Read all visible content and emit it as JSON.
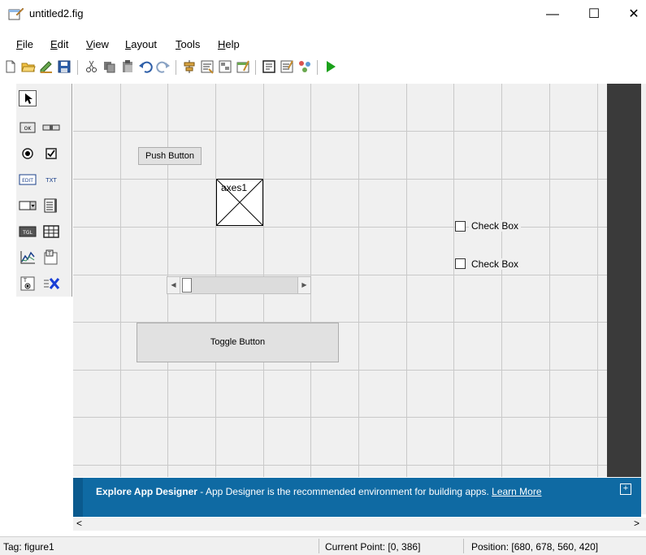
{
  "window": {
    "title": "untitled2.fig",
    "minimize_glyph": "—",
    "maximize_glyph": "☐",
    "close_glyph": "✕"
  },
  "menu": {
    "items": [
      {
        "mnemonic": "F",
        "rest": "ile"
      },
      {
        "mnemonic": "E",
        "rest": "dit"
      },
      {
        "mnemonic": "V",
        "rest": "iew"
      },
      {
        "mnemonic": "L",
        "rest": "ayout"
      },
      {
        "mnemonic": "T",
        "rest": "ools"
      },
      {
        "mnemonic": "H",
        "rest": "elp"
      }
    ]
  },
  "toolbar": {
    "icons": [
      "new-file-icon",
      "open-folder-icon",
      "edit-icon",
      "save-icon",
      "cut-icon",
      "copy-icon",
      "paste-icon",
      "undo-icon",
      "redo-icon",
      "align-icon",
      "menu-editor-icon",
      "tab-order-icon",
      "toolbar-editor-icon",
      "editor-icon",
      "property-inspector-icon",
      "object-browser-icon",
      "run-icon"
    ]
  },
  "palette": {
    "items": [
      {
        "name": "select-tool-icon",
        "glyph": "➤"
      },
      {
        "name": "push-button-tool-icon",
        "glyph": "OK"
      },
      {
        "name": "slider-tool-icon",
        "glyph": "▭"
      },
      {
        "name": "radio-button-tool-icon",
        "glyph": "◉"
      },
      {
        "name": "check-box-tool-icon",
        "glyph": "☑"
      },
      {
        "name": "edit-text-tool-icon",
        "glyph": "EDIT"
      },
      {
        "name": "static-text-tool-icon",
        "glyph": "TXT"
      },
      {
        "name": "popup-menu-tool-icon",
        "glyph": "▭"
      },
      {
        "name": "listbox-tool-icon",
        "glyph": "☰"
      },
      {
        "name": "toggle-button-tool-icon",
        "glyph": "TGL"
      },
      {
        "name": "table-tool-icon",
        "glyph": "▦"
      },
      {
        "name": "axes-tool-icon",
        "glyph": "📈"
      },
      {
        "name": "panel-tool-icon",
        "glyph": "T"
      },
      {
        "name": "button-group-tool-icon",
        "glyph": "T"
      },
      {
        "name": "activex-tool-icon",
        "glyph": "X"
      }
    ]
  },
  "canvas": {
    "push_button_label": "Push Button",
    "axes_label": "axes1",
    "toggle_button_label": "Toggle Button",
    "checkbox1_label": "Check Box",
    "checkbox2_label": "Check Box",
    "slider_left_glyph": "◀",
    "slider_right_glyph": "▶"
  },
  "banner": {
    "title": "Explore App Designer",
    "separator": " - ",
    "body": "App Designer is the recommended environment for building apps. ",
    "link": "Learn More",
    "expand_glyph": "+"
  },
  "hscroll": {
    "left_glyph": "<",
    "right_glyph": ">"
  },
  "status": {
    "tag": "Tag: figure1",
    "current_point": "Current Point:  [0, 386]",
    "position": "Position: [680, 678, 560, 420]"
  },
  "colors": {
    "banner": "#0f6aa3",
    "canvas": "#f0f0f0",
    "grid": "#c9c9c9",
    "dark_panel": "#3a3a3a",
    "run_green": "#1aa11a"
  }
}
